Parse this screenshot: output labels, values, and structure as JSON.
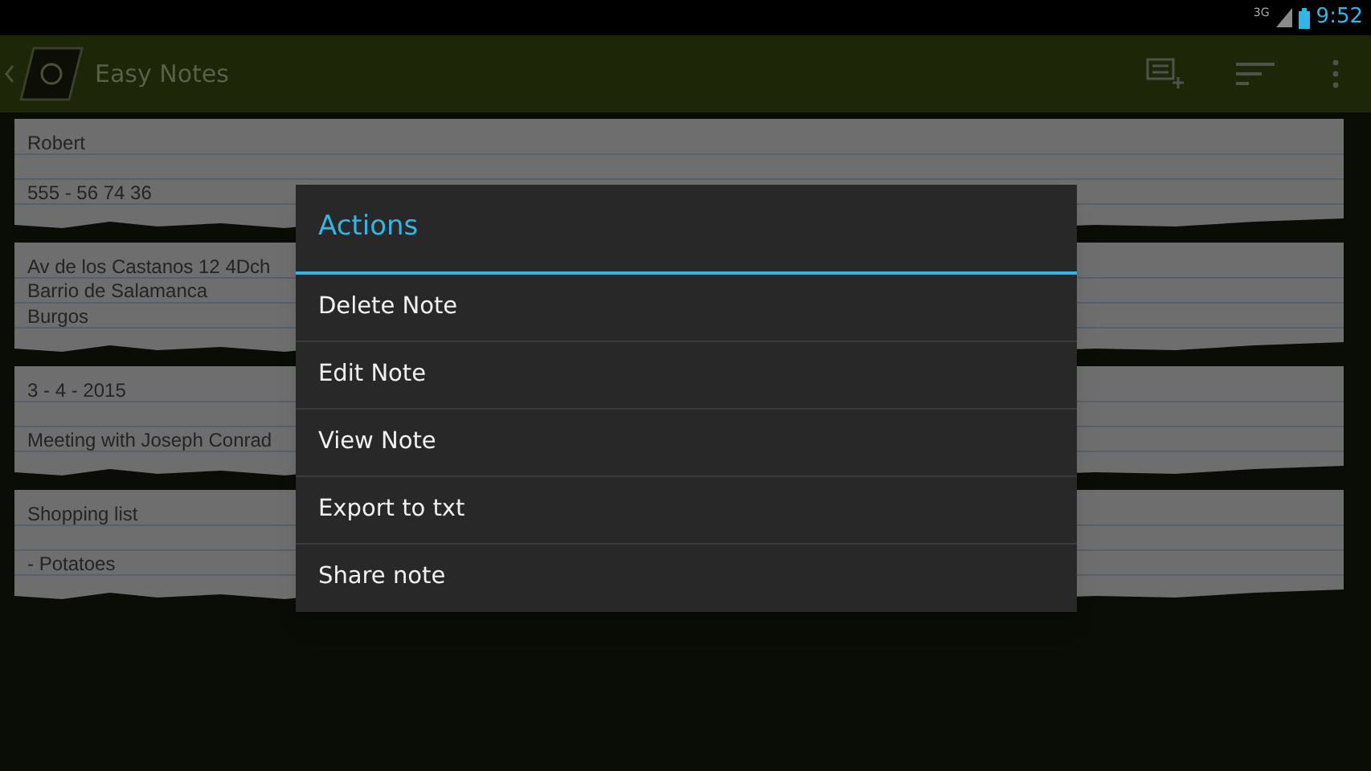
{
  "status_bar": {
    "network": "3G",
    "time": "9:52"
  },
  "action_bar": {
    "title": "Easy Notes"
  },
  "notes": [
    {
      "title": "Robert",
      "body": [
        "555 - 56 74 36"
      ]
    },
    {
      "body": [
        "Av de los Castanos 12 4Dch",
        "Barrio de Salamanca",
        "Burgos"
      ]
    },
    {
      "title": "3 - 4 - 2015",
      "body": [
        "Meeting with Joseph Conrad"
      ]
    },
    {
      "title": "Shopping list",
      "body": [
        "- Potatoes"
      ]
    }
  ],
  "dialog": {
    "title": "Actions",
    "items": [
      "Delete Note",
      "Edit Note",
      "View Note",
      "Export to txt",
      "Share note"
    ]
  }
}
